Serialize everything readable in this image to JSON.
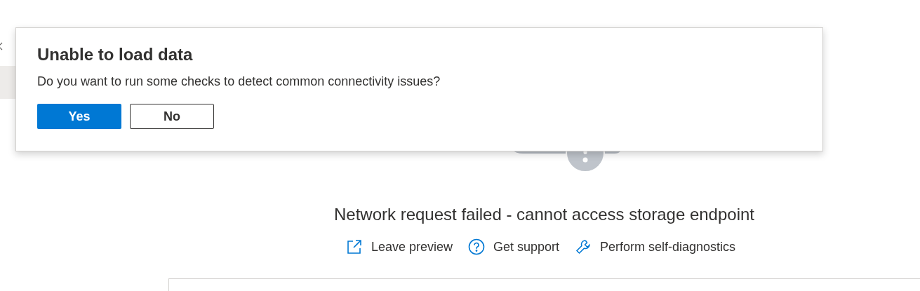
{
  "dialog": {
    "title": "Unable to load data",
    "message": "Do you want to run some checks to detect common connectivity issues?",
    "buttons": [
      {
        "label": "Yes",
        "kind": "primary"
      },
      {
        "label": "No",
        "kind": "secondary"
      }
    ]
  },
  "error": {
    "message": "Network request failed - cannot access storage endpoint",
    "links": [
      {
        "label": "Leave preview",
        "kind": "external"
      },
      {
        "label": "Get support",
        "kind": "help"
      },
      {
        "label": "Perform self-diagnostics",
        "kind": "wrench"
      }
    ]
  }
}
